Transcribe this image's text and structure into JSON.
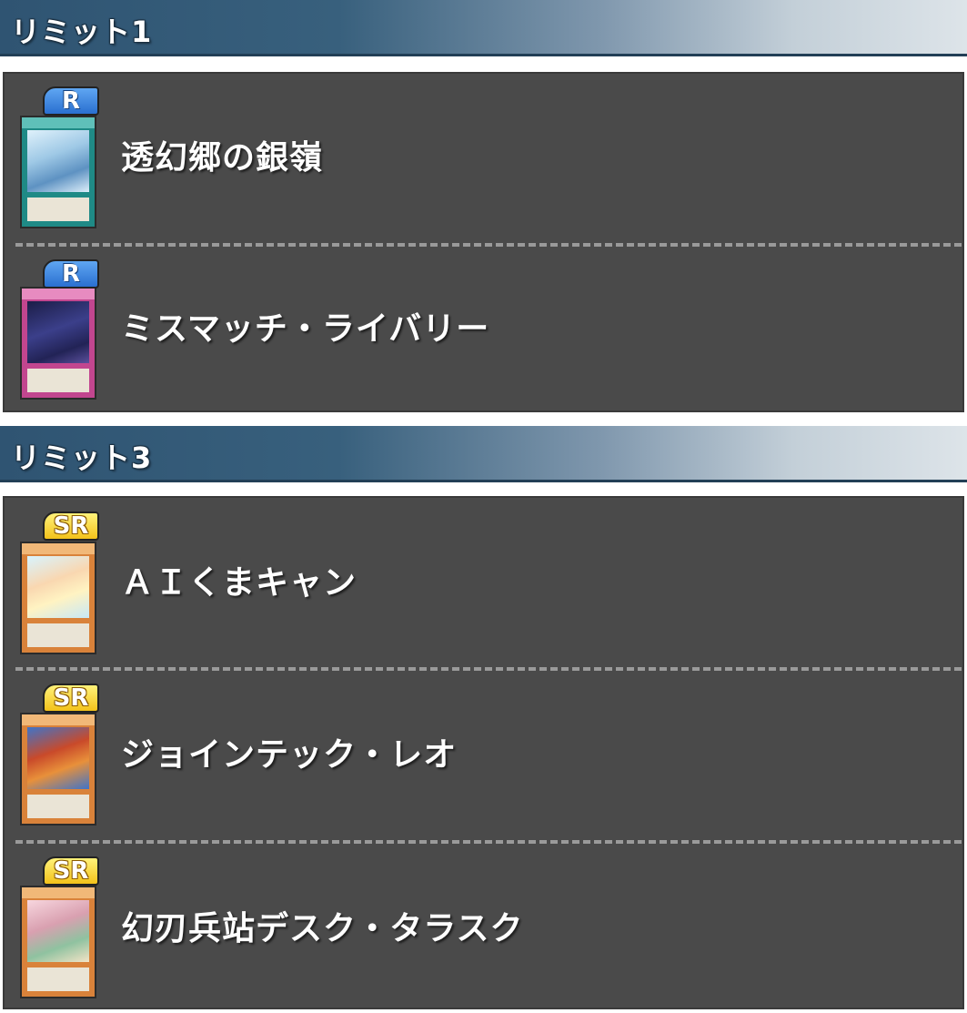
{
  "sections": [
    {
      "title": "リミット1",
      "cards": [
        {
          "rarity": "R",
          "name": "透幻郷の銀嶺",
          "frame_color": "#1f8a86"
        },
        {
          "rarity": "R",
          "name": "ミスマッチ・ライバリー",
          "frame_color": "#c2468f"
        }
      ]
    },
    {
      "title": "リミット3",
      "cards": [
        {
          "rarity": "SR",
          "name": "ＡＩくまキャン",
          "frame_color": "#d9823a"
        },
        {
          "rarity": "SR",
          "name": "ジョインテック・レオ",
          "frame_color": "#d9823a"
        },
        {
          "rarity": "SR",
          "name": "幻刃兵站デスク・タラスク",
          "frame_color": "#d9823a"
        }
      ]
    }
  ],
  "colors": {
    "header_dark": "#2f5472",
    "header_light": "#dde4e9",
    "panel_bg": "#4a4a4a",
    "rarity_r": "#2a6fd0",
    "rarity_sr": "#f3c21a"
  }
}
